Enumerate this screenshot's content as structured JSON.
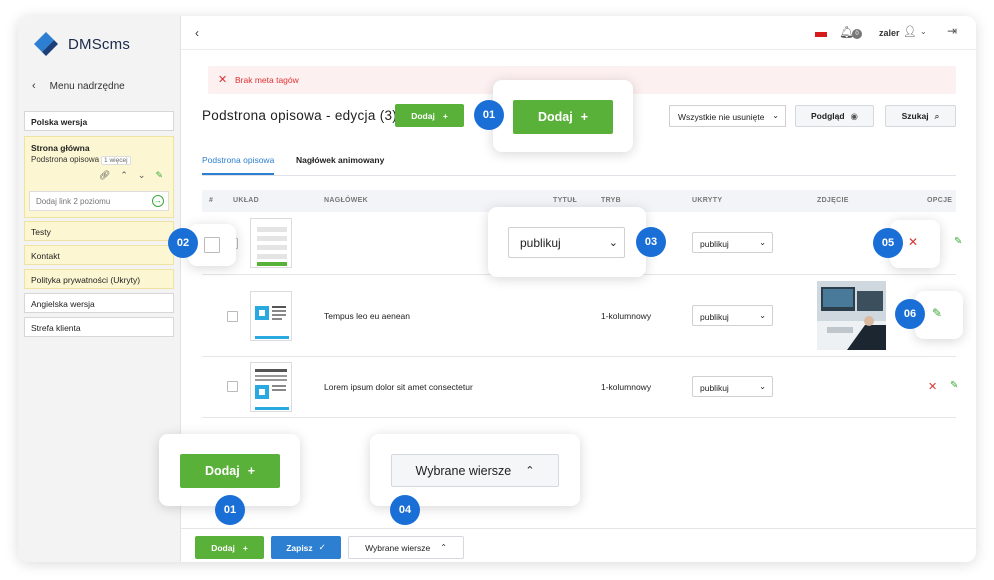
{
  "app": {
    "name": "DMScms"
  },
  "sidebar": {
    "back_label": "Menu nadrzędne",
    "items": [
      {
        "label": "Polska wersja"
      },
      {
        "label": "Testy"
      },
      {
        "label": "Kontakt"
      },
      {
        "label": "Polityka prywatności (Ukryty)"
      },
      {
        "label": "Angielska wersja"
      },
      {
        "label": "Strefa klienta"
      }
    ],
    "selected": {
      "title": "Strona główna",
      "subtitle": "Podstrona opisowa",
      "badge": "1 więcej",
      "input_placeholder": "Dodaj link 2 poziomu"
    }
  },
  "topbar": {
    "user": "zaler",
    "notifications": "0",
    "flag_color": "#d61b1b"
  },
  "alert": {
    "message": "Brak meta tagów",
    "color": "#d33333"
  },
  "page": {
    "title": "Podstrona opisowa - edycja (3)"
  },
  "toolbar": {
    "add_label": "Dodaj",
    "filter_value": "Wszystkie nie usunięte",
    "preview_label": "Podgląd",
    "search_label": "Szukaj"
  },
  "tabs": [
    {
      "label": "Podstrona opisowa"
    },
    {
      "label": "Nagłówek animowany"
    }
  ],
  "table": {
    "headers": [
      "#",
      "UKŁAD",
      "NAGŁÓWEK",
      "TYTUŁ",
      "TRYB",
      "UKRYTY",
      "ZDJĘCIE",
      "OPCJE"
    ],
    "rows": [
      {
        "heading": "",
        "mode": "",
        "hidden": "publikuj"
      },
      {
        "heading": "Tempus leo eu aenean",
        "mode": "1-kolumnowy",
        "hidden": "publikuj"
      },
      {
        "heading": "Lorem ipsum dolor sit amet consectetur",
        "mode": "1-kolumnowy",
        "hidden": "publikuj"
      }
    ]
  },
  "callouts": {
    "add_label": "Dodaj",
    "select_value": "publikuj",
    "selected_rows_label": "Wybrane wiersze",
    "numbers": [
      "01",
      "02",
      "03",
      "04",
      "05",
      "06",
      "01"
    ]
  },
  "bottom": {
    "add_label": "Dodaj",
    "save_label": "Zapisz",
    "selected_rows_label": "Wybrane wiersze"
  },
  "colors": {
    "green": "#5ab13a",
    "blue": "#2d7fd2",
    "badge_blue": "#1a6fd6"
  }
}
